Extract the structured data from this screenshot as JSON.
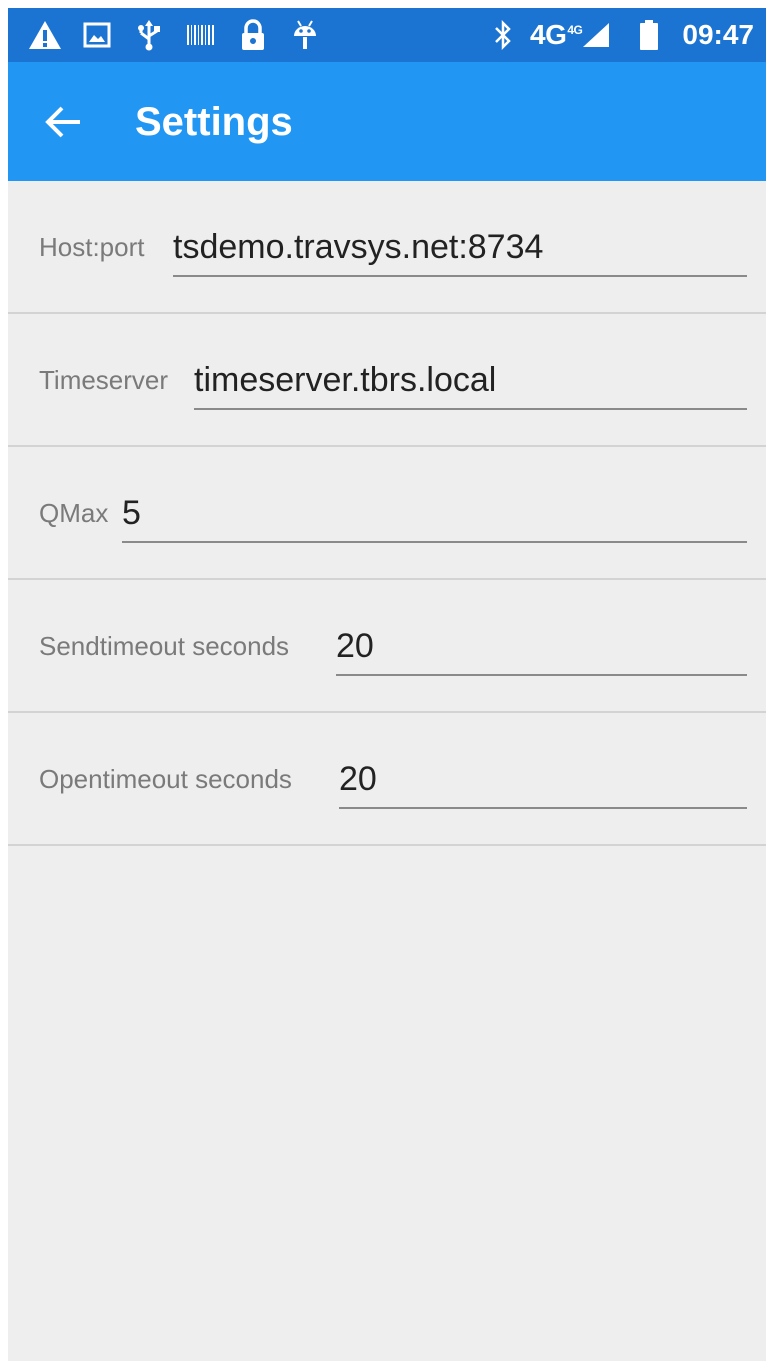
{
  "status_bar": {
    "left_icons": [
      "warning-icon",
      "image-icon",
      "usb-icon",
      "barcode-icon",
      "lock-icon",
      "android-icon"
    ],
    "bluetooth_icon": "bluetooth-icon",
    "network_label": "4G",
    "network_sup": "4G",
    "signal_icon": "signal-icon",
    "battery_icon": "battery-icon",
    "time": "09:47"
  },
  "toolbar": {
    "back_icon": "arrow-left-icon",
    "title": "Settings",
    "background": "#2196f3"
  },
  "settings": [
    {
      "label": "Host:port",
      "value": "tsdemo.travsys.net:8734"
    },
    {
      "label": "Timeserver",
      "value": "timeserver.tbrs.local"
    },
    {
      "label": "QMax",
      "value": "5"
    },
    {
      "label": "Sendtimeout seconds",
      "value": "20"
    },
    {
      "label": "Opentimeout seconds",
      "value": "20"
    }
  ]
}
